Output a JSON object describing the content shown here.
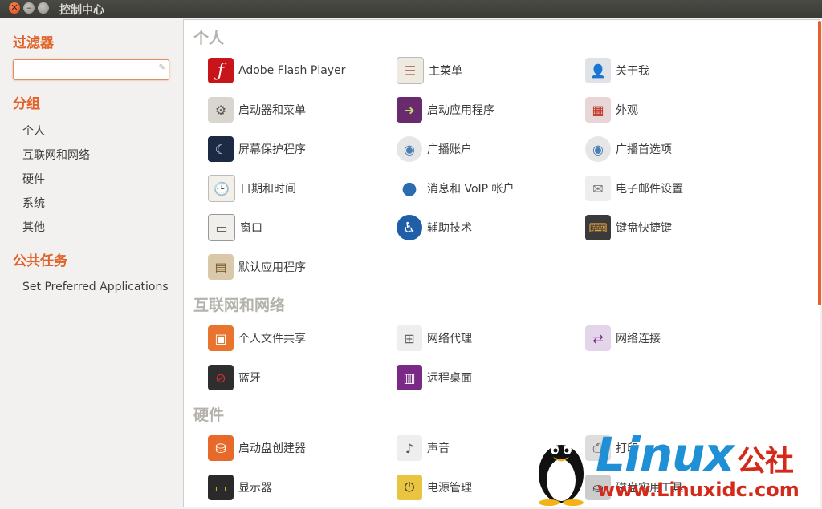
{
  "window": {
    "title": "控制中心"
  },
  "sidebar": {
    "filter_heading": "过滤器",
    "filter_value": "",
    "groups_heading": "分组",
    "groups": [
      "个人",
      "互联网和网络",
      "硬件",
      "系统",
      "其他"
    ],
    "tasks_heading": "公共任务",
    "tasks": [
      "Set Preferred Applications"
    ]
  },
  "sections": [
    {
      "title": "个人",
      "items": [
        {
          "label": "Adobe Flash Player",
          "icon": "flash-icon"
        },
        {
          "label": "主菜单",
          "icon": "main-menu-icon"
        },
        {
          "label": "关于我",
          "icon": "about-me-icon"
        },
        {
          "label": "启动器和菜单",
          "icon": "launcher-menu-icon"
        },
        {
          "label": "启动应用程序",
          "icon": "startup-apps-icon"
        },
        {
          "label": "外观",
          "icon": "appearance-icon"
        },
        {
          "label": "屏幕保护程序",
          "icon": "screensaver-icon"
        },
        {
          "label": "广播账户",
          "icon": "broadcast-accounts-icon"
        },
        {
          "label": "广播首选项",
          "icon": "broadcast-prefs-icon"
        },
        {
          "label": "日期和时间",
          "icon": "date-time-icon"
        },
        {
          "label": "消息和 VoIP 帐户",
          "icon": "messaging-voip-icon"
        },
        {
          "label": "电子邮件设置",
          "icon": "email-settings-icon"
        },
        {
          "label": "窗口",
          "icon": "windows-icon"
        },
        {
          "label": "辅助技术",
          "icon": "accessibility-icon"
        },
        {
          "label": "键盘快捷键",
          "icon": "keyboard-shortcuts-icon"
        },
        {
          "label": "默认应用程序",
          "icon": "default-apps-icon"
        }
      ]
    },
    {
      "title": "互联网和网络",
      "items": [
        {
          "label": "个人文件共享",
          "icon": "file-sharing-icon"
        },
        {
          "label": "网络代理",
          "icon": "network-proxy-icon"
        },
        {
          "label": "网络连接",
          "icon": "network-connections-icon"
        },
        {
          "label": "蓝牙",
          "icon": "bluetooth-icon"
        },
        {
          "label": "远程桌面",
          "icon": "remote-desktop-icon"
        }
      ]
    },
    {
      "title": "硬件",
      "items": [
        {
          "label": "启动盘创建器",
          "icon": "startup-disk-icon"
        },
        {
          "label": "声音",
          "icon": "sound-icon"
        },
        {
          "label": "打印",
          "icon": "printer-icon"
        },
        {
          "label": "显示器",
          "icon": "display-icon"
        },
        {
          "label": "电源管理",
          "icon": "power-icon"
        },
        {
          "label": "磁盘实用工具",
          "icon": "disk-utility-icon"
        }
      ]
    }
  ],
  "watermark": {
    "brand": "Linux",
    "brand_cn": "公社",
    "url": "www.Linuxidc.com"
  },
  "colors": {
    "accent": "#e0642a",
    "section_heading": "#b5b2ae",
    "watermark_blue": "#1f8fd6",
    "watermark_red": "#d42a1c"
  }
}
